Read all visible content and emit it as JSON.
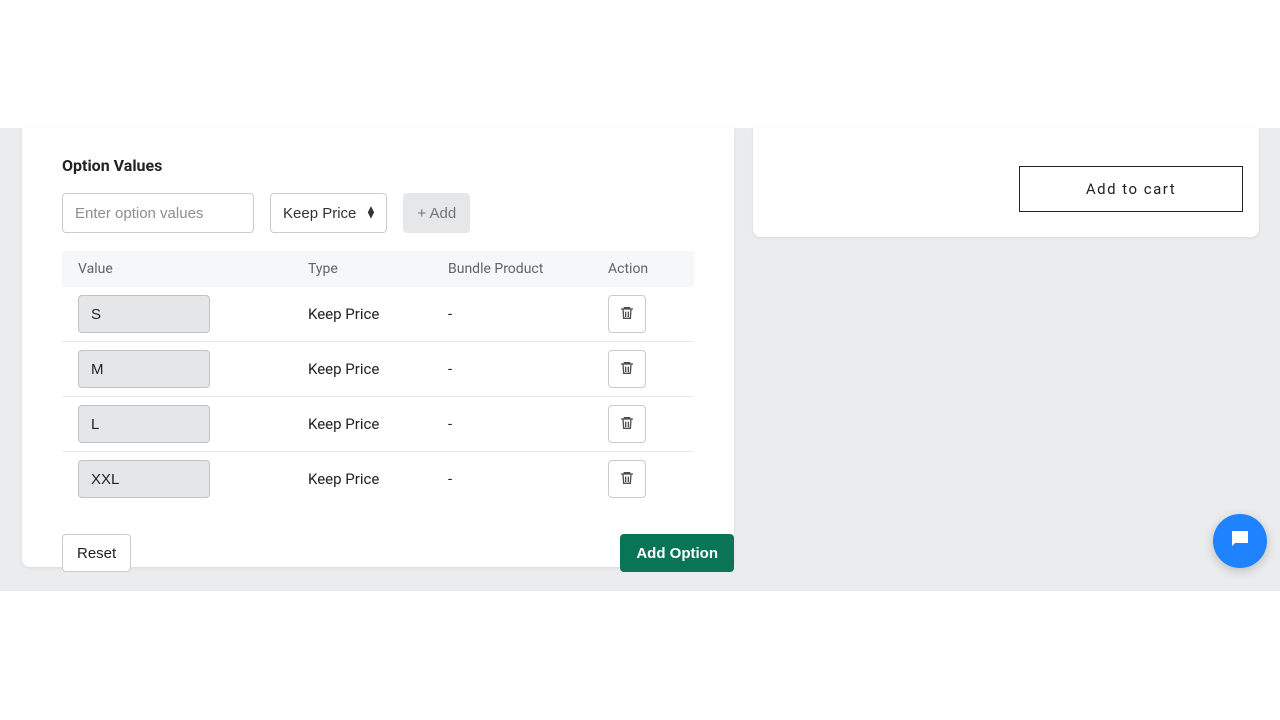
{
  "option_values": {
    "section_title": "Option Values",
    "input_placeholder": "Enter option values",
    "price_select": "Keep Price",
    "add_button": "+ Add",
    "columns": {
      "value": "Value",
      "type": "Type",
      "bundle": "Bundle Product",
      "action": "Action"
    },
    "rows": [
      {
        "value": "S",
        "type": "Keep Price",
        "bundle": "-"
      },
      {
        "value": "M",
        "type": "Keep Price",
        "bundle": "-"
      },
      {
        "value": "L",
        "type": "Keep Price",
        "bundle": "-"
      },
      {
        "value": "XXL",
        "type": "Keep Price",
        "bundle": "-"
      }
    ],
    "reset_label": "Reset",
    "add_option_label": "Add Option"
  },
  "cart": {
    "add_label": "Add to cart"
  },
  "colors": {
    "primary": "#0a7556",
    "chat": "#1f82ff"
  }
}
